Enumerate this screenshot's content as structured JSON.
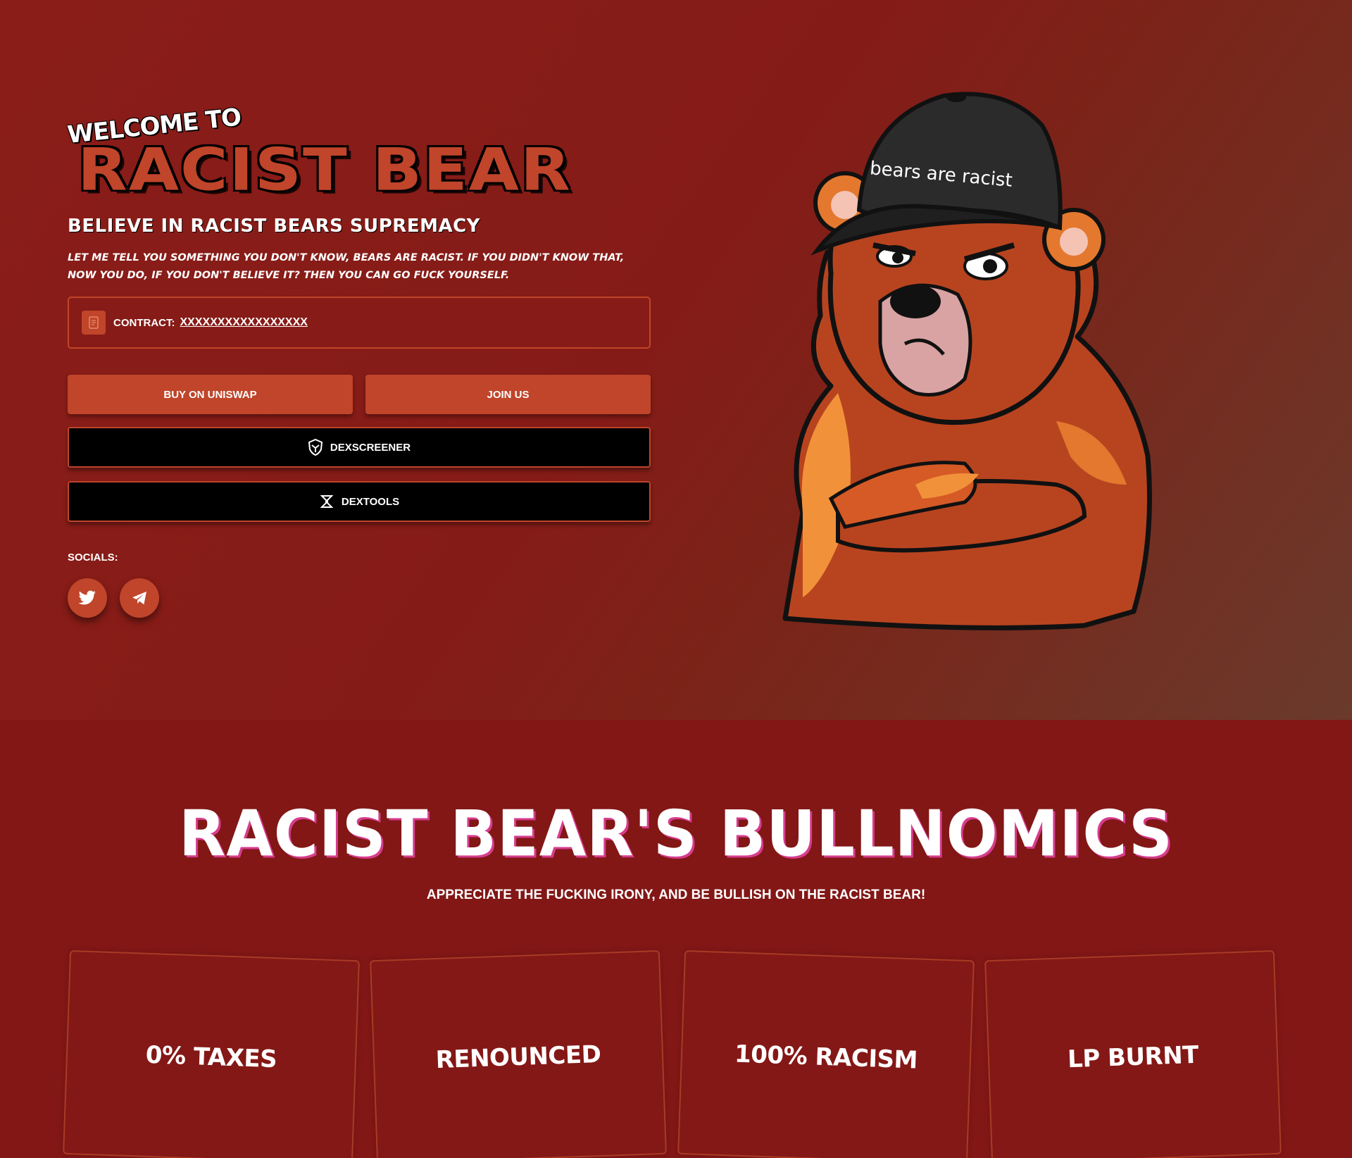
{
  "hero": {
    "welcome": "WELCOME TO",
    "title": "RACIST BEAR",
    "tagline": "BELIEVE IN RACIST BEARS SUPREMACY",
    "description": "LET ME TELL YOU SOMETHING YOU DON'T KNOW, BEARS ARE RACIST. IF YOU DIDN'T KNOW THAT, NOW YOU DO, IF YOU DON'T BELIEVE IT? THEN YOU CAN GO FUCK YOURSELF.",
    "contract_label": "CONTRACT:",
    "contract_value": "XXXXXXXXXXXXXXXXX",
    "buttons": {
      "buy": "BUY ON UNISWAP",
      "join": "JOIN US",
      "dexscreener": "DEXSCREENER",
      "dextools": "DEXTOOLS"
    },
    "socials_label": "SOCIALS:",
    "bear_cap_text": "bears are racist"
  },
  "bullnomics": {
    "title": "RACIST BEAR'S BULLNOMICS",
    "subtitle": "APPRECIATE THE FUCKING IRONY, AND BE BULLISH ON THE RACIST BEAR!",
    "cards": [
      "0% TAXES",
      "RENOUNCED",
      "100% RACISM",
      "LP BURNT"
    ]
  },
  "colors": {
    "background": "#821716",
    "accent": "#c0452a",
    "title_shadow": "#d63d8e"
  },
  "icons": [
    "copy-icon",
    "dexscreener-icon",
    "dextools-icon",
    "twitter-icon",
    "telegram-icon"
  ]
}
